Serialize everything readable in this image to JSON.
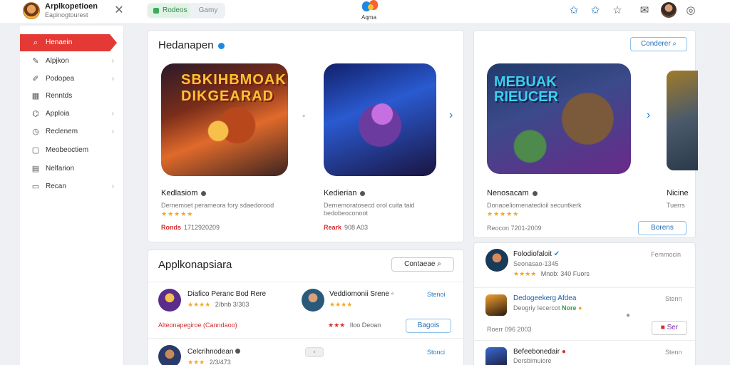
{
  "header": {
    "app_name": "Arplkopetioen",
    "app_sub": "Eapinogtourest",
    "toggle_a": "Rodeos",
    "toggle_b": "Gamy",
    "brand_text": "Aqma",
    "icons": [
      "star-icon",
      "star-icon",
      "favorite-icon",
      "mail-icon",
      "chat-icon"
    ]
  },
  "sidebar": {
    "items": [
      {
        "label": "Henaein",
        "icon": "search-icon",
        "active": true
      },
      {
        "label": "Alpjkon",
        "icon": "edit-icon"
      },
      {
        "label": "Podopea",
        "icon": "pen-icon"
      },
      {
        "label": "Renntds",
        "icon": "grid-icon"
      },
      {
        "label": "Apploia",
        "icon": "tag-icon"
      },
      {
        "label": "Reclenem",
        "icon": "clock-icon"
      },
      {
        "label": "Meobeoctiem",
        "icon": "box-icon"
      },
      {
        "label": "Nelfarion",
        "icon": "calendar-icon"
      },
      {
        "label": "Recan",
        "icon": "settings-icon"
      }
    ]
  },
  "featured": {
    "title": "Hedanapen",
    "cards": [
      {
        "logo": "SBKIHBMOAK\nDIKGEARAD",
        "title": "Kedlasiom",
        "desc": "Dernemoet perameora fory sdaedorood",
        "stars": "★★★★★",
        "price": "Ronds",
        "meta": "1712920209"
      },
      {
        "title": "Kedierian",
        "desc": "Dernemoratosecd orol cuita taid bedobeoconoot",
        "price": "Reark",
        "meta": "908 A03"
      }
    ]
  },
  "featured2": {
    "button": "Conderer",
    "logo": "MEBUAK\nRIEUCER",
    "title": "Nenosacam",
    "desc": "Donaoeliomenatedioil secuntkerk",
    "stars": "★★★★★",
    "meta": "Reocon 7201-2009",
    "button2": "Borens",
    "next_title": "Nicine",
    "next_desc": "Tuerrs"
  },
  "apps": {
    "title": "Applkonapsiara",
    "button": "Contaeae",
    "rows": [
      {
        "title": "Diafico Peranc Bod Rere",
        "meta": "2/bnb 3/303",
        "promo": "Alteonapegiroe (Canndaoo)"
      },
      {
        "title": "Veddiomonii Srene",
        "link": "Stenoi",
        "meta": "Iloo Deoan",
        "button": "Bagois"
      },
      {
        "title": "Celcrihnodean",
        "meta": "2/3/473",
        "link": "Stonci"
      }
    ]
  },
  "apps2": {
    "rows": [
      {
        "title": "Folodiofaloit",
        "sub": "Seonasao-1345",
        "meta": "Mnob: 340 Fuors",
        "link": "Femmocin"
      },
      {
        "title": "Dedogeekerg Afdea",
        "sub": "Deogriy Iecercot",
        "meta": "Roerr 096 2003",
        "link": "Stenn",
        "badge": "Nore",
        "button": "Ser"
      },
      {
        "title": "Befeebonedair",
        "sub": "Dersbimuiore",
        "link": "Stenn"
      }
    ]
  },
  "colors": {
    "accent": "#e53935",
    "link": "#2b7bc4",
    "star": "#f5a623"
  }
}
